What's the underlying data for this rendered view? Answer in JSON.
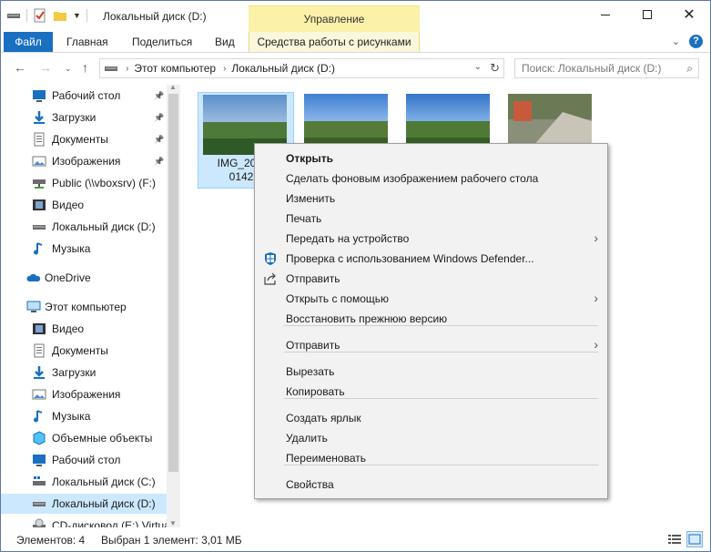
{
  "window": {
    "title": "Локальный диск (D:)",
    "context_tab_header": "Управление",
    "minimize_icon": "minimize-icon",
    "maximize_icon": "maximize-icon",
    "close_icon": "close-icon"
  },
  "ribbon": {
    "tabs": [
      {
        "label": "Файл"
      },
      {
        "label": "Главная"
      },
      {
        "label": "Поделиться"
      },
      {
        "label": "Вид"
      },
      {
        "label": "Средства работы с рисунками"
      }
    ],
    "help": "?"
  },
  "address": {
    "crumbs": [
      "Этот компьютер",
      "Локальный диск (D:)"
    ],
    "search_placeholder": "Поиск: Локальный диск (D:)"
  },
  "nav": {
    "quick_access": [
      {
        "label": "Рабочий стол",
        "pinned": true,
        "icon": "desktop-icon"
      },
      {
        "label": "Загрузки",
        "pinned": true,
        "icon": "download-icon"
      },
      {
        "label": "Документы",
        "pinned": true,
        "icon": "documents-icon"
      },
      {
        "label": "Изображения",
        "pinned": true,
        "icon": "pictures-icon"
      },
      {
        "label": "Public (\\\\vboxsrv) (F:)",
        "pinned": false,
        "icon": "network-drive-icon"
      },
      {
        "label": "Видео",
        "pinned": false,
        "icon": "video-icon"
      },
      {
        "label": "Локальный диск (D:)",
        "pinned": false,
        "icon": "drive-icon"
      },
      {
        "label": "Музыка",
        "pinned": false,
        "icon": "music-icon"
      }
    ],
    "onedrive": {
      "label": "OneDrive",
      "icon": "onedrive-icon"
    },
    "this_pc": {
      "label": "Этот компьютер",
      "icon": "computer-icon"
    },
    "pc_items": [
      {
        "label": "Видео",
        "icon": "video-icon"
      },
      {
        "label": "Документы",
        "icon": "documents-icon"
      },
      {
        "label": "Загрузки",
        "icon": "download-icon"
      },
      {
        "label": "Изображения",
        "icon": "pictures-icon"
      },
      {
        "label": "Музыка",
        "icon": "music-icon"
      },
      {
        "label": "Объемные объекты",
        "icon": "3d-objects-icon"
      },
      {
        "label": "Рабочий стол",
        "icon": "desktop-icon"
      },
      {
        "label": "Локальный диск (C:)",
        "icon": "system-drive-icon"
      },
      {
        "label": "Локальный диск (D:)",
        "icon": "drive-icon",
        "selected": true
      },
      {
        "label": "CD-дисковод (E:) Virtua",
        "icon": "cd-drive-icon"
      }
    ]
  },
  "files": [
    {
      "label_line1": "IMG_20180",
      "label_line2": "0142.p",
      "selected": true,
      "palette": [
        "#5b8ec9",
        "#9bbbe0",
        "#4d7a3a",
        "#2f5a25"
      ]
    },
    {
      "label_line1": "",
      "label_line2": "",
      "selected": false,
      "palette": [
        "#3f7fd0",
        "#8ab7ea",
        "#567a38",
        "#3b6026"
      ]
    },
    {
      "label_line1": "",
      "label_line2": "",
      "selected": false,
      "palette": [
        "#3574c8",
        "#7fb0e6",
        "#4e7a36",
        "#365f25"
      ]
    },
    {
      "label_line1": "",
      "label_line2": "",
      "selected": false,
      "palette": [
        "#6a7a55",
        "#c85a3c",
        "#c9c4b8",
        "#8a8f7a"
      ]
    }
  ],
  "context_menu": {
    "items": [
      {
        "label": "Открыть",
        "bold": true
      },
      {
        "label": "Сделать фоновым изображением рабочего стола"
      },
      {
        "label": "Изменить"
      },
      {
        "label": "Печать"
      },
      {
        "label": "Передать на устройство",
        "submenu": true
      },
      {
        "label": "Проверка с использованием Windows Defender...",
        "icon": "windows-defender-icon"
      },
      {
        "label": "Отправить",
        "icon": "share-icon"
      },
      {
        "label": "Открыть с помощью",
        "submenu": true
      },
      {
        "label": "Восстановить прежнюю версию"
      },
      {
        "label": "Отправить",
        "submenu": true,
        "group": 2
      },
      {
        "label": "Вырезать",
        "group": 3
      },
      {
        "label": "Копировать",
        "group": 3
      },
      {
        "label": "Создать ярлык",
        "group": 4
      },
      {
        "label": "Удалить",
        "group": 4
      },
      {
        "label": "Переименовать",
        "group": 4
      },
      {
        "label": "Свойства",
        "group": 5
      }
    ]
  },
  "status": {
    "items_count": "Элементов: 4",
    "selected": "Выбран 1 элемент: 3,01 МБ"
  },
  "colors": {
    "accent": "#1a6fc0",
    "selection": "#cce8ff",
    "context_tab": "#fbf1a8"
  }
}
